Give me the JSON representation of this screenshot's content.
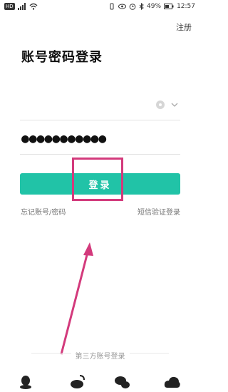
{
  "status_bar": {
    "left_icons": [
      "hd-badge",
      "signal-icon",
      "wifi-icon"
    ],
    "battery_percent": "49%",
    "time": "12:57",
    "right_icons": [
      "vibrate-icon",
      "eye-icon",
      "alarm-icon",
      "bluetooth-icon",
      "battery-icon"
    ]
  },
  "header": {
    "register": "注册"
  },
  "title": "账号密码登录",
  "form": {
    "account_value": "",
    "password_value": "●●●●●●●●●●●",
    "login_label": "登录"
  },
  "links": {
    "forgot": "忘记账号/密码",
    "sms_login": "短信验证登录"
  },
  "third_party": {
    "label": "第三方账号登录",
    "icons": [
      "qq-icon",
      "weibo-icon",
      "wechat-icon",
      "cloud-icon"
    ]
  },
  "colors": {
    "accent": "#21c3a7",
    "annotation": "#d33a7c"
  }
}
